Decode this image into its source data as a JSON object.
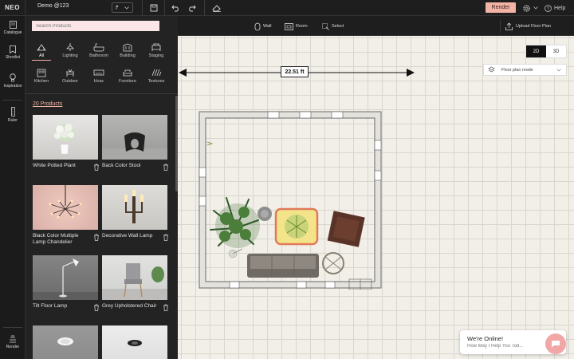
{
  "app": {
    "brand": "NEO",
    "project_name": "Demo @123",
    "project_select_glyph": "⁋",
    "render_label": "Render",
    "help_label": "Help"
  },
  "rail": {
    "items": [
      {
        "label": "Catalogue",
        "icon": "catalogue-icon"
      },
      {
        "label": "Shortlist",
        "icon": "shortlist-icon"
      },
      {
        "label": "Inspiration",
        "icon": "bulb-icon"
      },
      {
        "label": "Ruler",
        "icon": "ruler-icon"
      },
      {
        "label": "Render",
        "icon": "render-icon"
      }
    ]
  },
  "catalog": {
    "search_placeholder": "Search Products",
    "categories": [
      {
        "label": "All",
        "active": true
      },
      {
        "label": "Lighting"
      },
      {
        "label": "Bathroom"
      },
      {
        "label": "Building"
      },
      {
        "label": "Staging"
      },
      {
        "label": "Kitchen"
      },
      {
        "label": "Outdoor"
      },
      {
        "label": "Hvac"
      },
      {
        "label": "Furniture"
      },
      {
        "label": "Textures"
      }
    ],
    "count_label": "20 Products",
    "products": [
      {
        "name": "White Potted Plant"
      },
      {
        "name": "Back Color Stool"
      },
      {
        "name": "Black Color Multiple Lamp Chandelier"
      },
      {
        "name": "Decorative Wall Lamp"
      },
      {
        "name": "Tilt Floor Lamp"
      },
      {
        "name": "Grey Upholstered Chair"
      }
    ]
  },
  "toolstrip": {
    "wall_label": "Wall",
    "room_label": "Room",
    "select_label": "Select",
    "upload_label": "Upload Floor Plan"
  },
  "canvas": {
    "view_2d": "2D",
    "view_3d": "3D",
    "active_view": "2D",
    "mode_label": "Floor plan mode",
    "dimension_label": "22.51 ft"
  },
  "chat": {
    "title": "We're Online!",
    "subtitle": "How May I Help You Tod..."
  },
  "colors": {
    "accent": "#f2b3a6",
    "panel": "#232323",
    "canvas": "#f1efe8"
  }
}
